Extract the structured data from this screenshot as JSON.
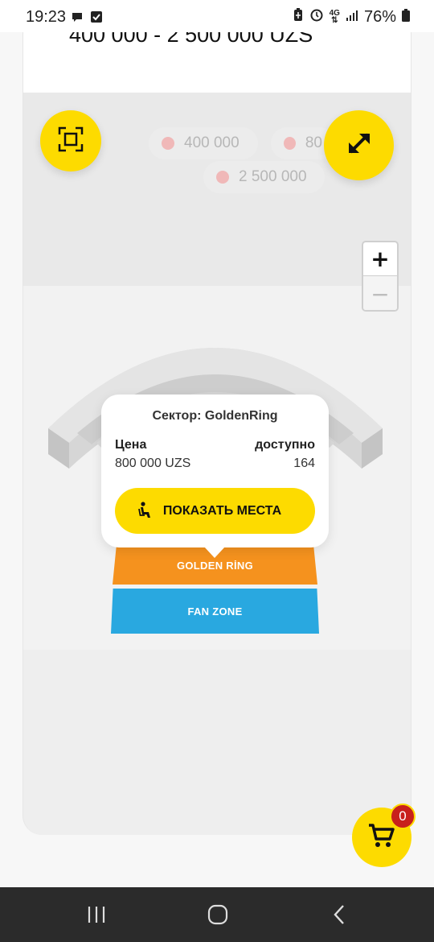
{
  "status_bar": {
    "time": "19:23",
    "network": "4G",
    "battery": "76%",
    "icons": [
      "chat-icon",
      "check-icon",
      "battery-saver-icon",
      "alarm-icon",
      "network-icon",
      "signal-icon",
      "battery-icon"
    ]
  },
  "header": {
    "price_range": "400 000 - 2 500 000 UZS"
  },
  "legend": {
    "chips": [
      {
        "label": "400 000"
      },
      {
        "label": "80"
      },
      {
        "label": "2 500 000"
      }
    ],
    "dot_color": "#f0b8b8"
  },
  "map": {
    "zoom_in": "+",
    "zoom_out": "−",
    "sectors": [
      {
        "name": "GOLDEN RİNG",
        "color": "#f5921e"
      },
      {
        "name": "FAN ZONE",
        "color": "#29a8e0"
      }
    ]
  },
  "popup": {
    "title": "Сектор: GoldenRing",
    "price_label": "Цена",
    "price_value": "800 000 UZS",
    "available_label": "доступно",
    "available_value": "164",
    "button_label": "ПОКАЗАТЬ МЕСТА"
  },
  "cart": {
    "count": "0"
  },
  "colors": {
    "accent": "#fddb00",
    "badge": "#c8201c"
  }
}
